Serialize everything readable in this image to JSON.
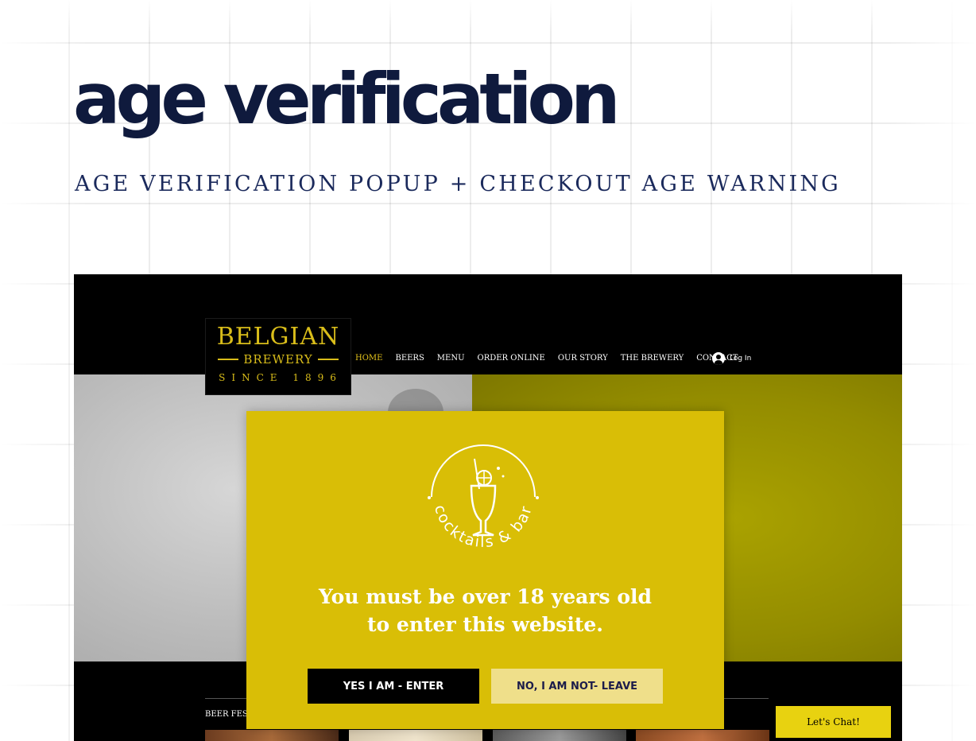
{
  "hero": {
    "title": "age verification",
    "subtitle": "AGE VERIFICATION POPUP + CHECKOUT AGE WARNING"
  },
  "site": {
    "logo": {
      "name": "BELGIAN",
      "sub": "BREWERY",
      "since": "SINCE 1896"
    },
    "nav": [
      "HOME",
      "BEERS",
      "MENU",
      "ORDER ONLINE",
      "OUR STORY",
      "THE BREWERY",
      "CONTACT"
    ],
    "active_nav": "HOME",
    "login_label": "Log In",
    "section_label": "BEER FES",
    "chat_label": "Let's Chat!"
  },
  "modal": {
    "logo_text": "cocktails & bar",
    "message_line1": "You must be over 18 years old",
    "message_line2": "to enter this website.",
    "yes_label": "YES I AM - ENTER",
    "no_label": "NO, I AM NOT- LEAVE"
  },
  "colors": {
    "accent_yellow": "#d9be06",
    "brand_gold": "#d9bd1a",
    "title_navy": "#0f1a3d"
  },
  "icons": {
    "login": "user-avatar-icon",
    "modal_logo": "cocktail-glass-icon"
  }
}
